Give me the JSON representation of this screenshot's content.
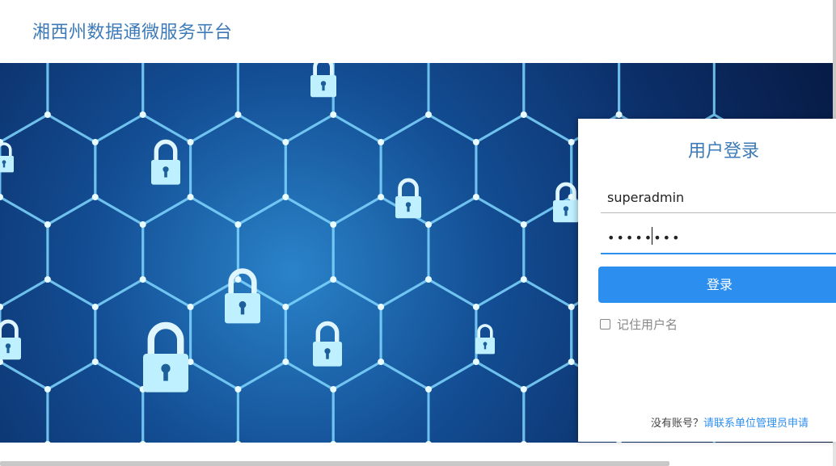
{
  "header": {
    "title": "湘西州数据通微服务平台"
  },
  "login": {
    "title": "用户登录",
    "username_value": "superadmin",
    "password_value": "••••••••",
    "submit_label": "登录",
    "remember_label": "记住用户名",
    "remember_checked": false,
    "footer_prefix": "没有账号？",
    "footer_link": "请联系单位管理员申请"
  },
  "banner": {
    "icon": "padlock-icon"
  },
  "colors": {
    "brand": "#3d7ab8",
    "accent": "#2c8ff0"
  }
}
